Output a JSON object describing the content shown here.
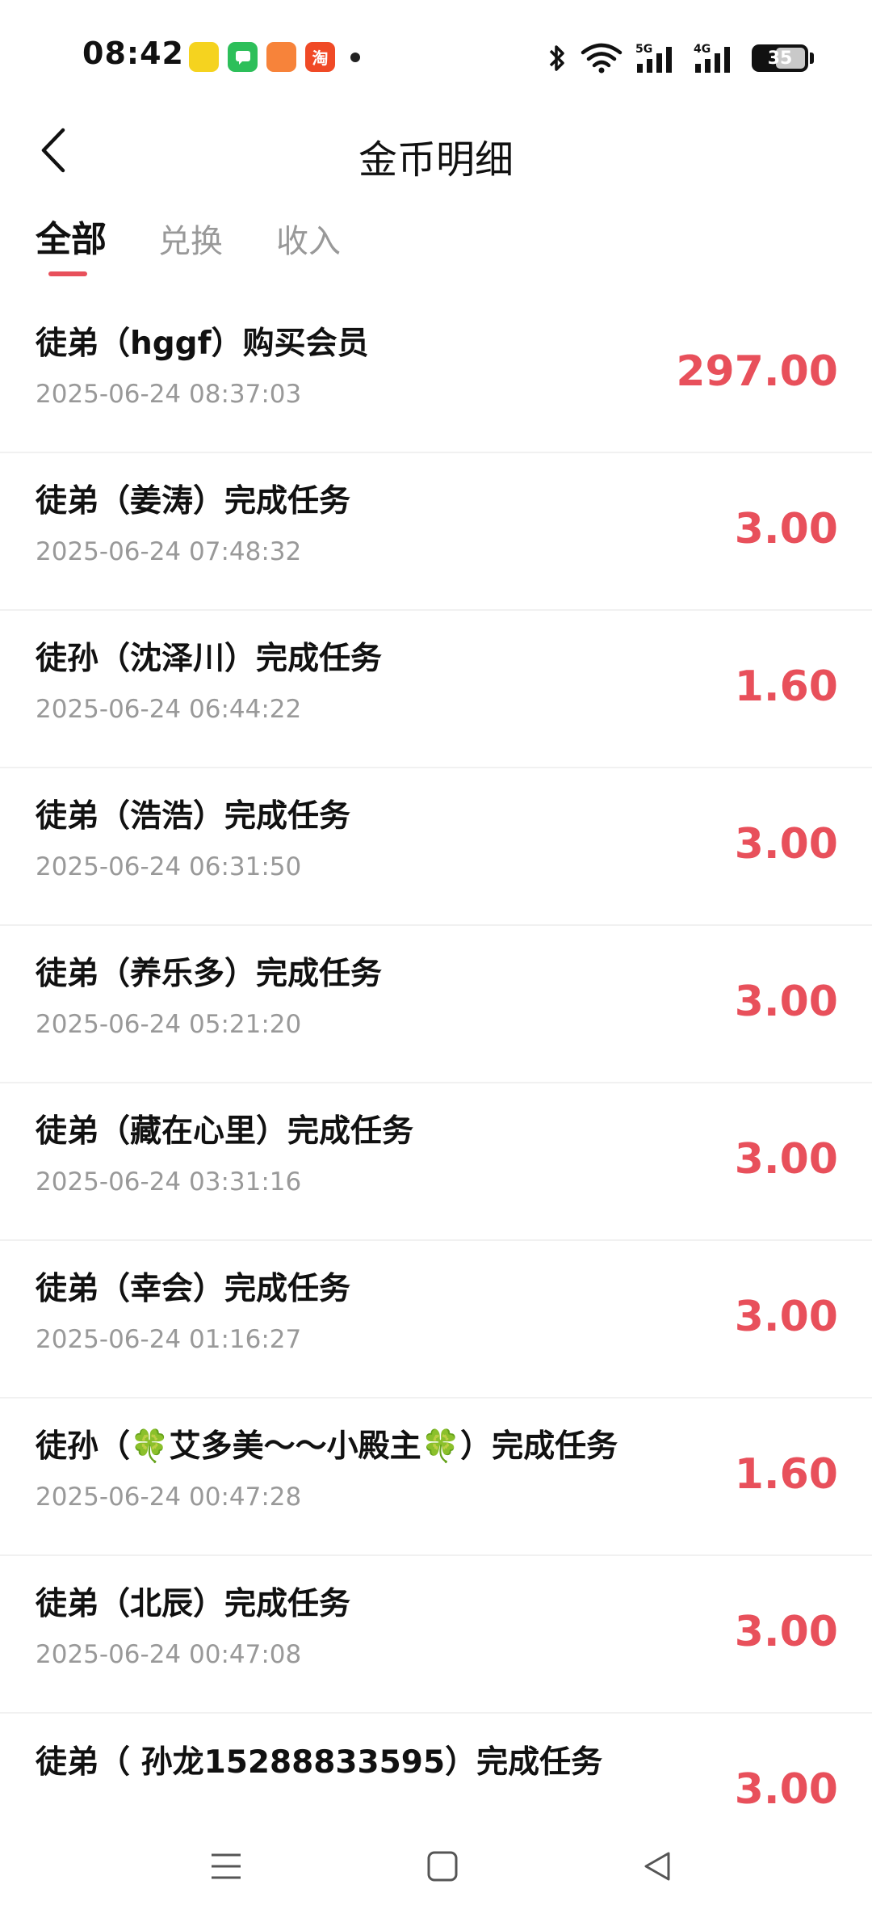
{
  "status_bar": {
    "time": "08:42",
    "battery": "35",
    "network_5g": "5G",
    "network_4g": "4G"
  },
  "header": {
    "title": "金币明细"
  },
  "tabs": [
    {
      "label": "全部",
      "active": true
    },
    {
      "label": "兑换",
      "active": false
    },
    {
      "label": "收入",
      "active": false
    }
  ],
  "records": [
    {
      "title": "徒弟（hggf）购买会员",
      "time": "2025-06-24 08:37:03",
      "amount": "297.00"
    },
    {
      "title": "徒弟（姜涛）完成任务",
      "time": "2025-06-24 07:48:32",
      "amount": "3.00"
    },
    {
      "title": "徒孙（沈泽川）完成任务",
      "time": "2025-06-24 06:44:22",
      "amount": "1.60"
    },
    {
      "title": "徒弟（浩浩）完成任务",
      "time": "2025-06-24 06:31:50",
      "amount": "3.00"
    },
    {
      "title": "徒弟（养乐多）完成任务",
      "time": "2025-06-24 05:21:20",
      "amount": "3.00"
    },
    {
      "title": "徒弟（藏在心里）完成任务",
      "time": "2025-06-24 03:31:16",
      "amount": "3.00"
    },
    {
      "title": "徒弟（幸会）完成任务",
      "time": "2025-06-24 01:16:27",
      "amount": "3.00"
    },
    {
      "title_prefix": "徒孙（",
      "title_name": "艾多美～～小殿主",
      "title_suffix": "）完成任务",
      "time": "2025-06-24 00:47:28",
      "amount": "1.60"
    },
    {
      "title": "徒弟（北辰）完成任务",
      "time": "2025-06-24 00:47:08",
      "amount": "3.00"
    },
    {
      "title": "徒弟（          孙龙15288833595）完成任务",
      "time": "",
      "amount": "3.00"
    }
  ],
  "colors": {
    "accent": "#e8505b",
    "text_primary": "#111111",
    "text_secondary": "#999999",
    "divider": "#f1f1f1"
  }
}
